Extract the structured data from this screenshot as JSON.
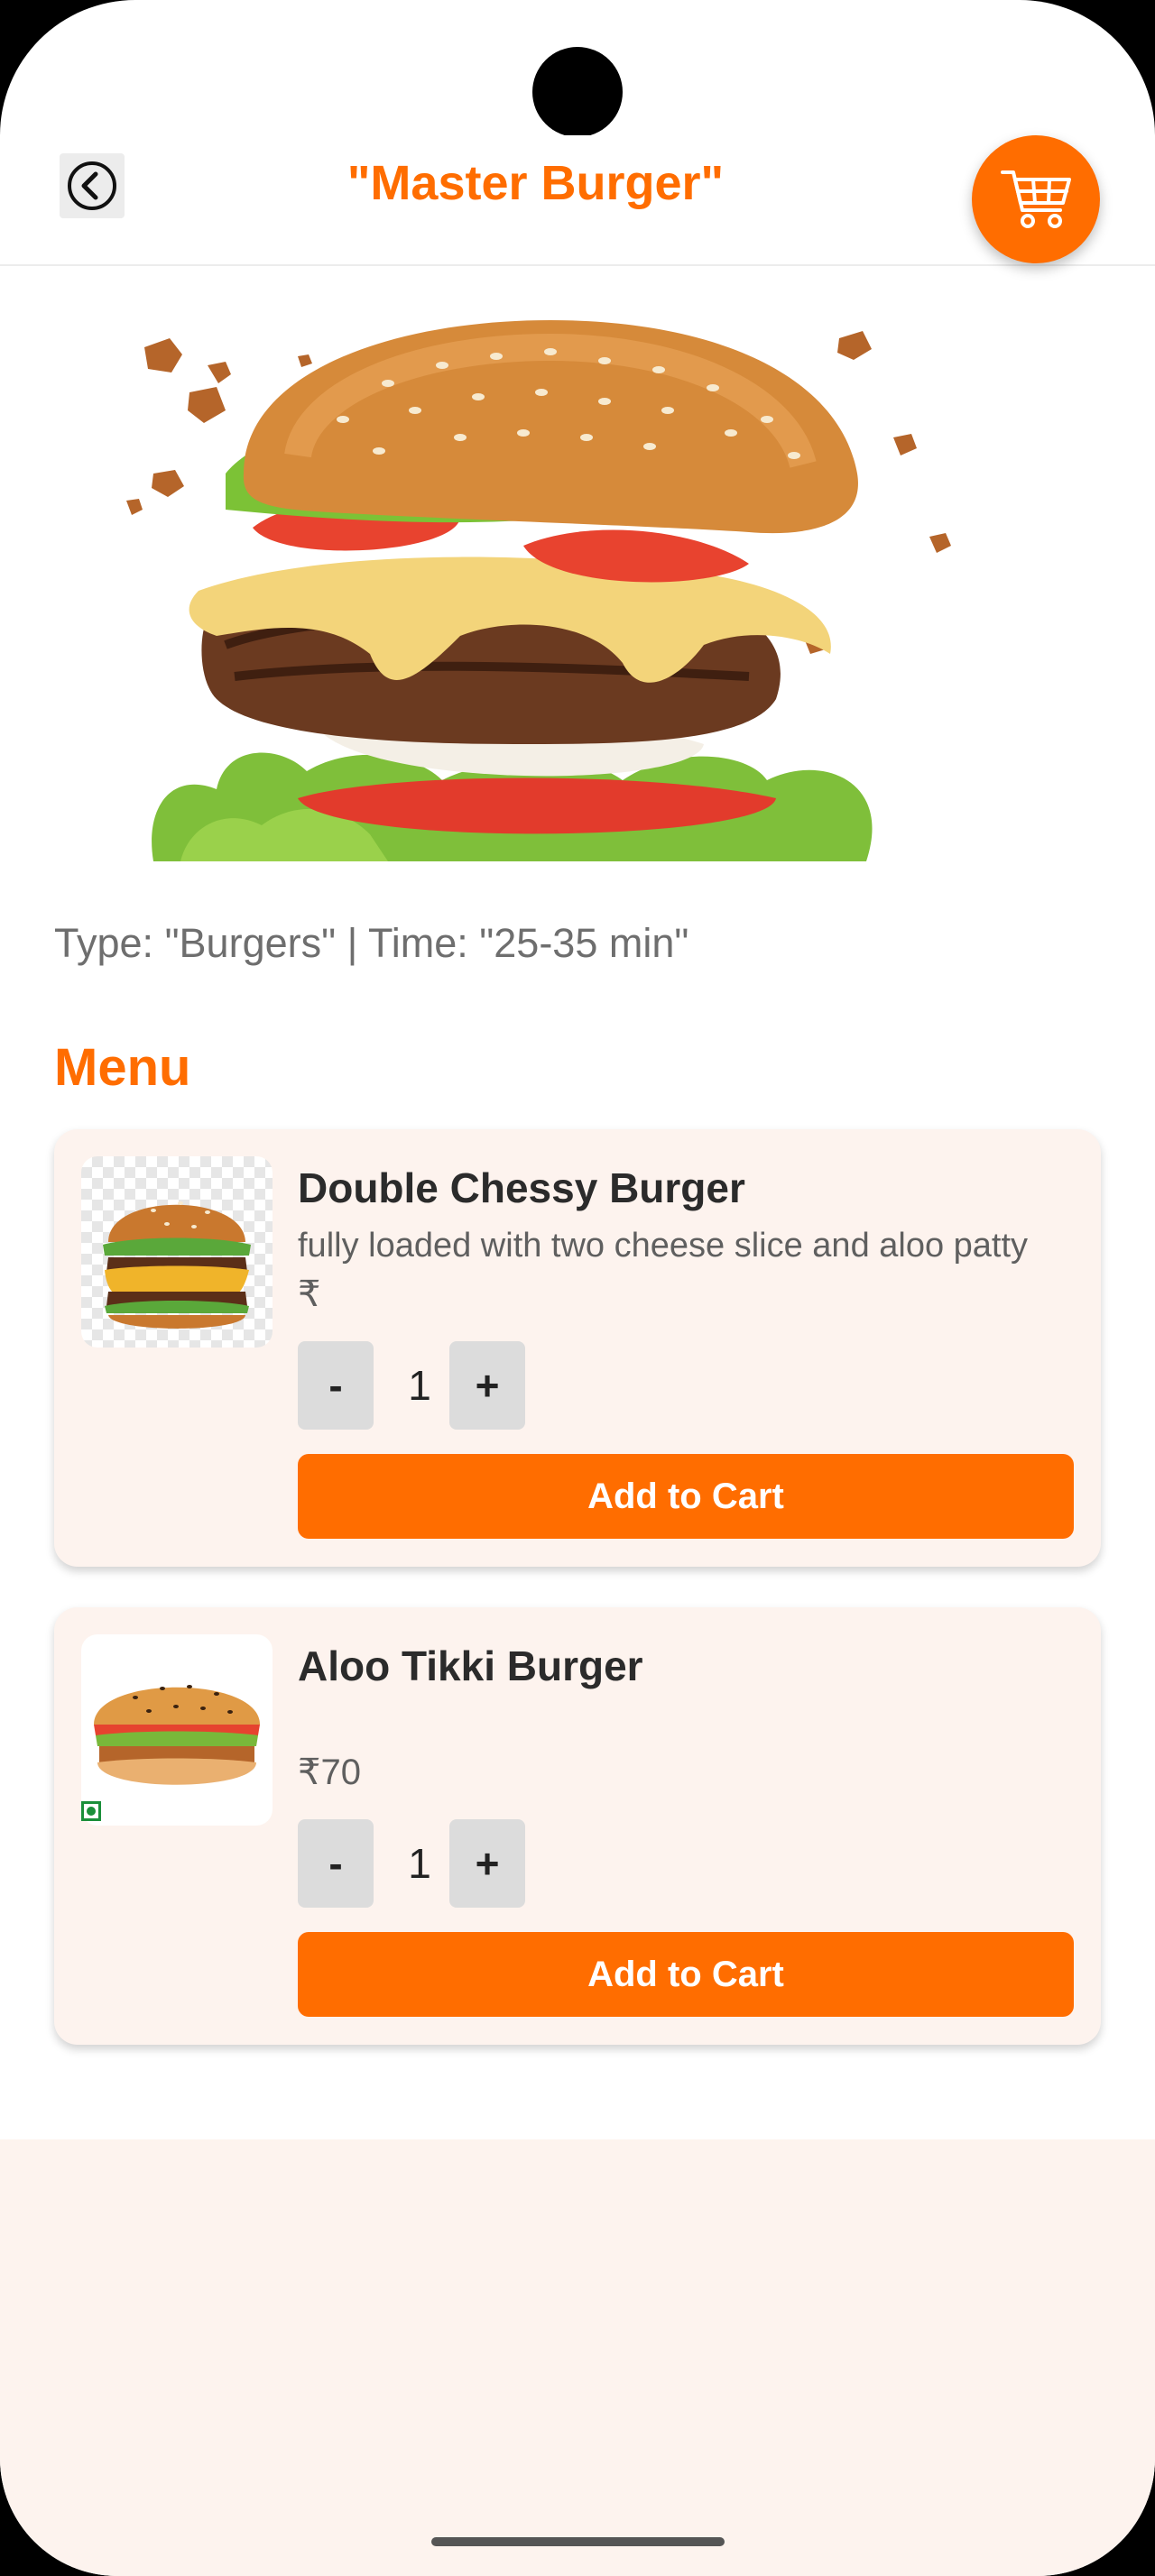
{
  "header": {
    "title": "\"Master Burger\"",
    "back_icon": "back-arrow-icon",
    "cart_icon": "shopping-cart-icon"
  },
  "restaurant": {
    "meta": "Type: \"Burgers\" | Time: \"25-35 min\""
  },
  "menu": {
    "heading": "Menu",
    "items": [
      {
        "name": "Double Chessy Burger",
        "description": "fully loaded with two cheese slice and aloo patty",
        "price": "₹",
        "quantity": "1",
        "minus_label": "-",
        "plus_label": "+",
        "add_label": "Add to Cart"
      },
      {
        "name": "Aloo Tikki Burger",
        "description": "",
        "price": "₹70",
        "quantity": "1",
        "minus_label": "-",
        "plus_label": "+",
        "add_label": "Add to Cart"
      }
    ]
  },
  "colors": {
    "accent": "#ff6d00",
    "card_bg": "#fdf3ee"
  }
}
